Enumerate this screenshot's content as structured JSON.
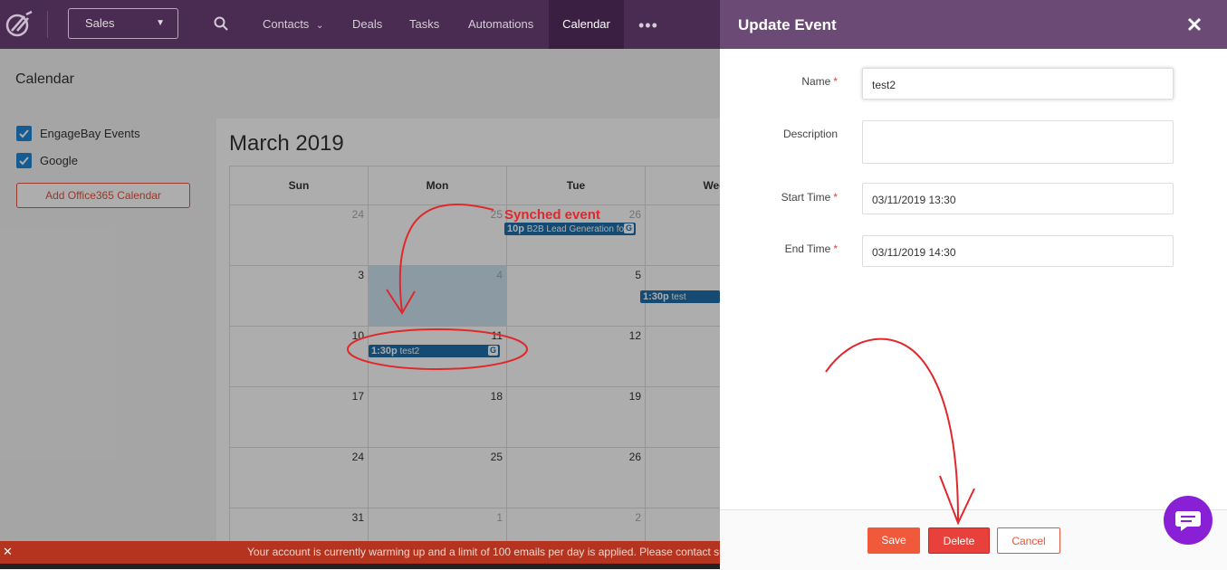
{
  "topbar": {
    "product_select": "Sales",
    "nav": [
      {
        "label": "Contacts"
      },
      {
        "label": "Deals"
      },
      {
        "label": "Tasks"
      },
      {
        "label": "Automations"
      },
      {
        "label": "Calendar",
        "active": true
      }
    ],
    "more": "•••"
  },
  "sidebar": {
    "title": "Calendar",
    "calendars": [
      {
        "label": "EngageBay Events",
        "checked": true
      },
      {
        "label": "Google",
        "checked": true
      }
    ],
    "add_button": "Add Office365 Calendar"
  },
  "calendar": {
    "month_title": "March 2019",
    "weekdays": [
      "Sun",
      "Mon",
      "Tue",
      "Wed"
    ],
    "weeks": [
      [
        "24",
        "25",
        "26",
        ""
      ],
      [
        "3",
        "4",
        "5",
        ""
      ],
      [
        "10",
        "11",
        "12",
        ""
      ],
      [
        "17",
        "18",
        "19",
        ""
      ],
      [
        "24",
        "25",
        "26",
        ""
      ],
      [
        "31",
        "1",
        "2",
        ""
      ]
    ],
    "events": [
      {
        "time": "10p",
        "title": "B2B Lead Generation fo",
        "google": true
      },
      {
        "time": "1:30p",
        "title": "test",
        "google": false
      },
      {
        "time": "1:30p",
        "title": "test2",
        "google": true
      }
    ],
    "google_badge": "G"
  },
  "annotation": {
    "label": "Synched event"
  },
  "banner": {
    "close": "✕",
    "text": "Your account is currently warming up and a limit of 100 emails per day is applied. Please contact su"
  },
  "modal": {
    "title": "Update Event",
    "fields": {
      "name": {
        "label": "Name",
        "value": "test2"
      },
      "description": {
        "label": "Description",
        "value": ""
      },
      "start_time": {
        "label": "Start Time",
        "value": "03/11/2019 13:30"
      },
      "end_time": {
        "label": "End Time",
        "value": "03/11/2019 14:30"
      }
    },
    "required_mark": "*",
    "buttons": {
      "save": "Save",
      "delete": "Delete",
      "cancel": "Cancel"
    }
  },
  "colors": {
    "topbar": "#4a2b52",
    "modal_header": "#6b4b75",
    "accent": "#f05a3a",
    "event": "#1f6fa8",
    "chat": "#8a20d6"
  }
}
